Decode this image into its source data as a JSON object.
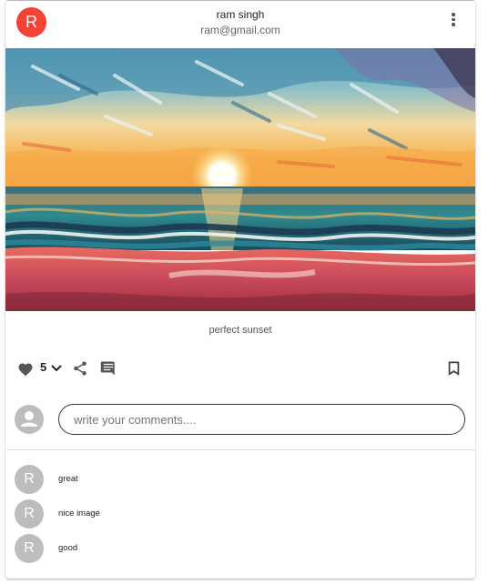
{
  "post": {
    "avatar_letter": "R",
    "user_name": "ram singh",
    "user_email": "ram@gmail.com",
    "caption": "perfect sunset",
    "like_count": "5",
    "avatar_color": "#f44336"
  },
  "icons": {
    "more": "more-vert-icon",
    "heart": "heart-icon",
    "expand": "chevron-down-icon",
    "share": "share-icon",
    "comment": "comment-icon",
    "bookmark": "bookmark-icon",
    "person": "person-icon"
  },
  "comment_input": {
    "placeholder": "write your comments...."
  },
  "comments": [
    {
      "avatar_letter": "R",
      "text": "great"
    },
    {
      "avatar_letter": "R",
      "text": "nice image"
    },
    {
      "avatar_letter": "R",
      "text": "good"
    }
  ]
}
